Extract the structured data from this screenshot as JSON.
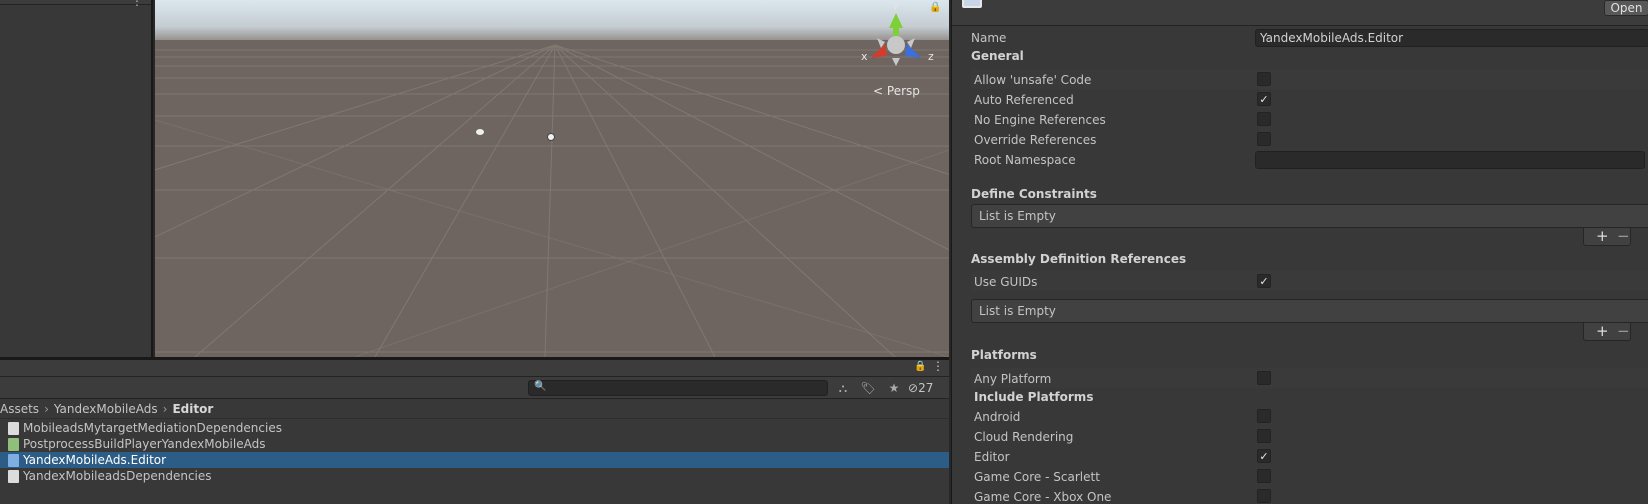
{
  "scene": {
    "persp_label": "Persp",
    "axis_x": "x",
    "axis_y": "y",
    "axis_z": "z"
  },
  "project": {
    "hidden_count": "27",
    "search_placeholder": "",
    "breadcrumb": [
      "Assets",
      "YandexMobileAds",
      "Editor"
    ],
    "files": [
      {
        "name": "MobileadsMytargetMediationDependencies",
        "icon": "text-file-icon",
        "selected": false
      },
      {
        "name": "PostprocessBuildPlayerYandexMobileAds",
        "icon": "csharp-script-icon",
        "selected": false
      },
      {
        "name": "YandexMobileAds.Editor",
        "icon": "assembly-definition-icon",
        "selected": true
      },
      {
        "name": "YandexMobileadsDependencies",
        "icon": "text-file-icon",
        "selected": false
      }
    ]
  },
  "inspector": {
    "open_button": "Open",
    "name_label": "Name",
    "name_value": "YandexMobileAds.Editor",
    "general_header": "General",
    "general": [
      {
        "label": "Allow 'unsafe' Code",
        "checked": false
      },
      {
        "label": "Auto Referenced",
        "checked": true
      },
      {
        "label": "No Engine References",
        "checked": false
      },
      {
        "label": "Override References",
        "checked": false
      }
    ],
    "root_namespace_label": "Root Namespace",
    "root_namespace_value": "",
    "define_constraints_header": "Define Constraints",
    "list_empty": "List is Empty",
    "asm_refs_header": "Assembly Definition References",
    "use_guids_label": "Use GUIDs",
    "use_guids_checked": true,
    "platforms_header": "Platforms",
    "any_platform_label": "Any Platform",
    "any_platform_checked": false,
    "include_platforms_header": "Include Platforms",
    "platforms": [
      {
        "label": "Android",
        "checked": false
      },
      {
        "label": "Cloud Rendering",
        "checked": false
      },
      {
        "label": "Editor",
        "checked": true
      },
      {
        "label": "Game Core - Scarlett",
        "checked": false
      },
      {
        "label": "Game Core - Xbox One",
        "checked": false
      }
    ],
    "plus": "+",
    "minus": "−"
  },
  "colors": {
    "selection": "#2c5d87",
    "panel": "#383838",
    "field": "#2a2a2a",
    "gizmo_x": "#d33b2c",
    "gizmo_y": "#7fcf3a",
    "gizmo_z": "#3b6fe0"
  }
}
